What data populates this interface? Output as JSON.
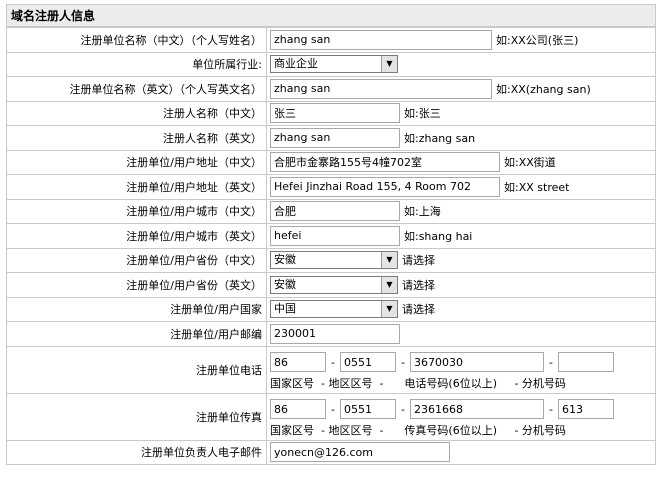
{
  "section_title": "域名注册人信息",
  "fields": {
    "org_cn": {
      "label": "注册单位名称（中文）（个人写姓名）",
      "value": "zhang san",
      "hint": "如:XX公司(张三)"
    },
    "industry": {
      "label": "单位所属行业:",
      "selected": "商业企业"
    },
    "org_en": {
      "label": "注册单位名称（英文）（个人写英文名）",
      "value": "zhang san",
      "hint": "如:XX(zhang san)"
    },
    "name_cn": {
      "label": "注册人名称（中文）",
      "value": "张三",
      "hint": "如:张三"
    },
    "name_en": {
      "label": "注册人名称（英文）",
      "value": "zhang san",
      "hint": "如:zhang san"
    },
    "addr_cn": {
      "label": "注册单位/用户地址（中文）",
      "value": "合肥市金寨路155号4幢702室",
      "hint": "如:XX街道"
    },
    "addr_en": {
      "label": "注册单位/用户地址（英文）",
      "value": "Hefei Jinzhai Road 155, 4 Room 702",
      "hint": "如:XX street"
    },
    "city_cn": {
      "label": "注册单位/用户城市（中文）",
      "value": "合肥",
      "hint": "如:上海"
    },
    "city_en": {
      "label": "注册单位/用户城市（英文）",
      "value": "hefei",
      "hint": "如:shang hai"
    },
    "prov_cn": {
      "label": "注册单位/用户省份（中文）",
      "selected": "安徽",
      "hint": "请选择"
    },
    "prov_en": {
      "label": "注册单位/用户省份（英文）",
      "selected": "安徽",
      "hint": "请选择"
    },
    "country": {
      "label": "注册单位/用户国家",
      "selected": "中国",
      "hint": "请选择"
    },
    "zip": {
      "label": "注册单位/用户邮编",
      "value": "230001"
    },
    "phone": {
      "label": "注册单位电话",
      "country": "86",
      "area": "0551",
      "number": "3670030",
      "ext": "",
      "captions": "国家区号  - 地区区号  -      电话号码(6位以上)     - 分机号码"
    },
    "fax": {
      "label": "注册单位传真",
      "country": "86",
      "area": "0551",
      "number": "2361668",
      "ext": "613",
      "captions": "国家区号  - 地区区号  -      传真号码(6位以上)     - 分机号码"
    },
    "email": {
      "label": "注册单位负责人电子邮件",
      "value": "yonecn@126.com"
    }
  },
  "icons": {
    "dropdown": "chevron-down-icon"
  }
}
